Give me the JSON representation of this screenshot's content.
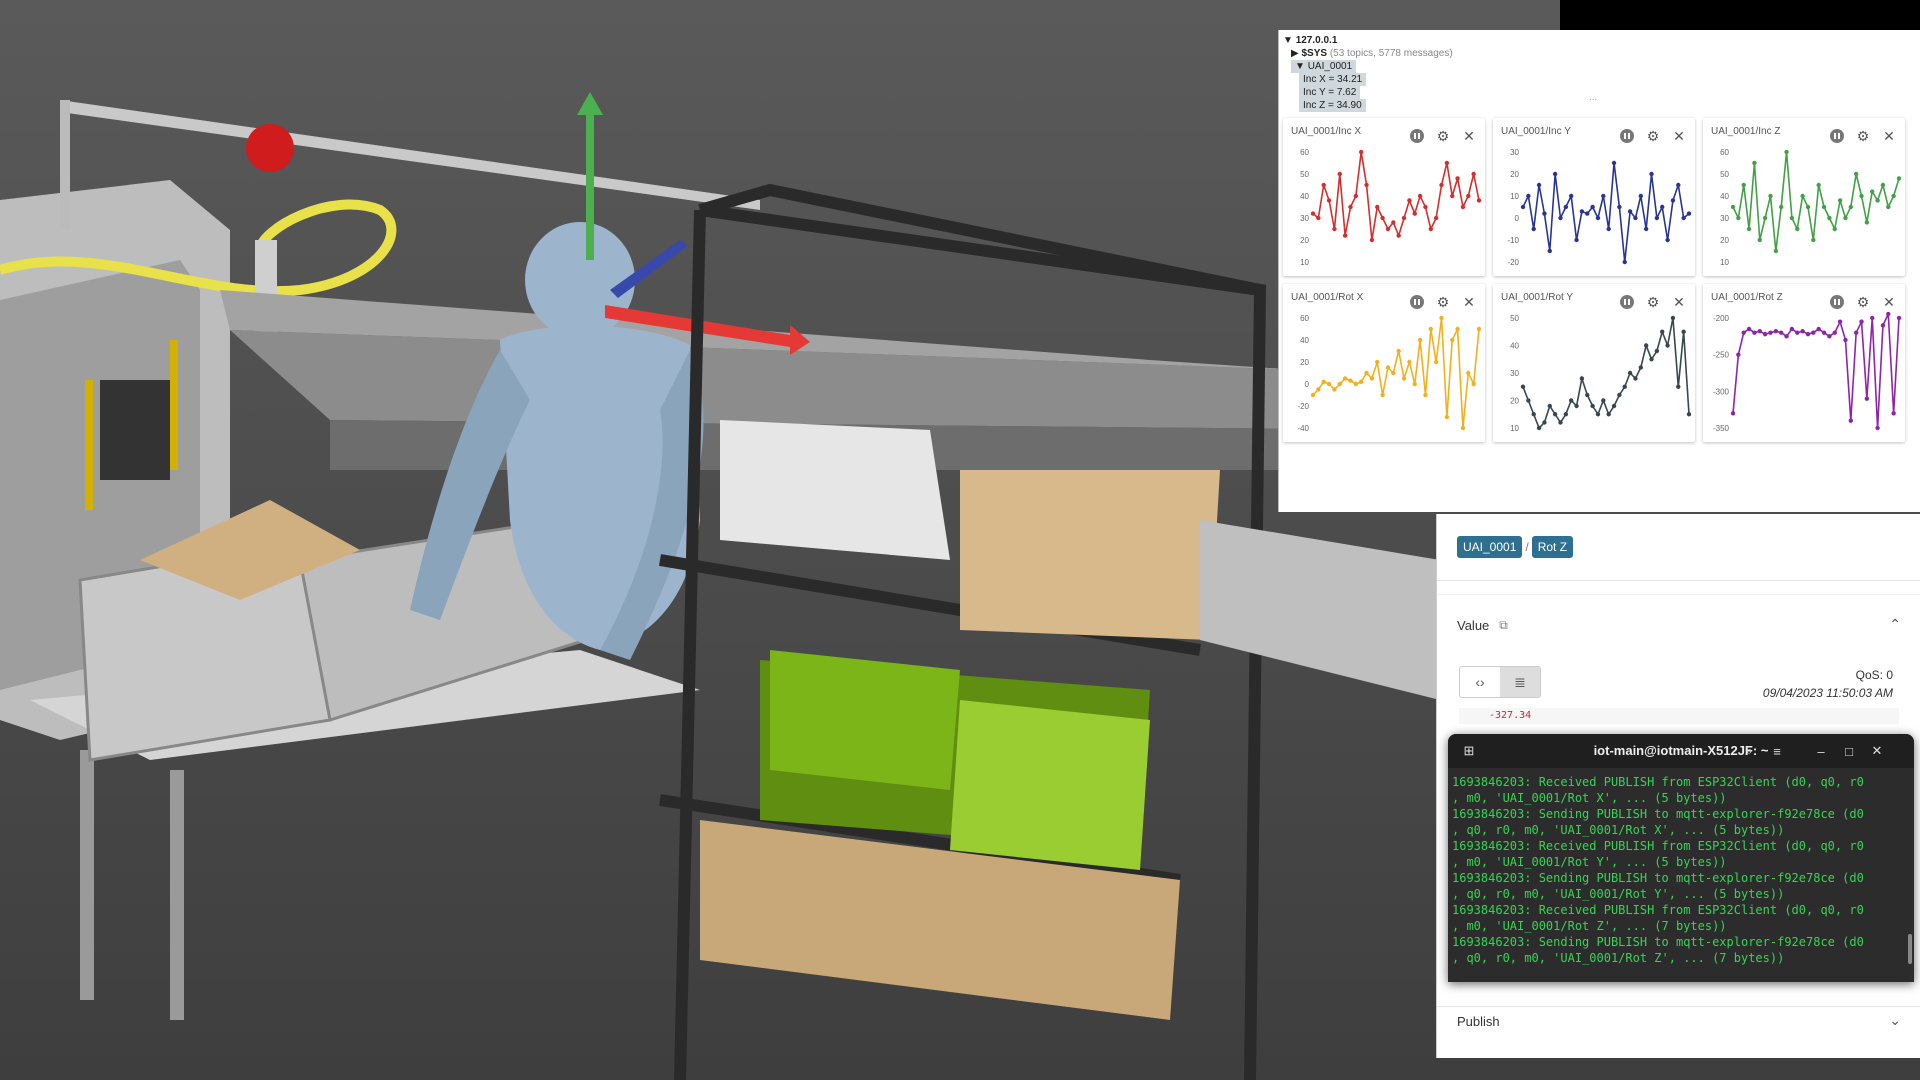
{
  "tree": {
    "root": "127.0.0.1",
    "sys_label": "$SYS",
    "sys_meta": "(53 topics, 5778 messages)",
    "device": "UAI_0001",
    "values": [
      "Inc X = 34.21",
      "Inc Y = 7.62",
      "Inc Z = 34.90"
    ],
    "more": "..."
  },
  "charts": [
    {
      "title": "UAI_0001/Inc X",
      "color": "#d32f2f",
      "yticks": [
        "60",
        "50",
        "40",
        "30",
        "20",
        "10"
      ]
    },
    {
      "title": "UAI_0001/Inc Y",
      "color": "#283593",
      "yticks": [
        "30",
        "20",
        "10",
        "0",
        "-10",
        "-20"
      ]
    },
    {
      "title": "UAI_0001/Inc Z",
      "color": "#43a047",
      "yticks": [
        "60",
        "50",
        "40",
        "30",
        "20",
        "10"
      ]
    },
    {
      "title": "UAI_0001/Rot X",
      "color": "#f2b01e",
      "yticks": [
        "60",
        "40",
        "20",
        "0",
        "-20",
        "-40"
      ]
    },
    {
      "title": "UAI_0001/Rot Y",
      "color": "#37474f",
      "yticks": [
        "50",
        "40",
        "30",
        "20",
        "10"
      ]
    },
    {
      "title": "UAI_0001/Rot Z",
      "color": "#8e24aa",
      "yticks": [
        "-200",
        "-250",
        "-300",
        "-350"
      ]
    }
  ],
  "chart_data": [
    {
      "type": "line",
      "series": [
        {
          "values": [
            32,
            30,
            45,
            38,
            25,
            50,
            22,
            35,
            40,
            60,
            45,
            20,
            35,
            30,
            25,
            28,
            22,
            30,
            38,
            32,
            40,
            35,
            25,
            30,
            45,
            55,
            40,
            48,
            35,
            40,
            50,
            38
          ]
        }
      ]
    },
    {
      "type": "line",
      "series": [
        {
          "values": [
            5,
            10,
            -5,
            15,
            2,
            -15,
            20,
            0,
            5,
            10,
            -10,
            3,
            2,
            5,
            0,
            10,
            -5,
            25,
            5,
            -20,
            3,
            0,
            10,
            -5,
            20,
            0,
            5,
            -10,
            8,
            15,
            0,
            2
          ]
        }
      ]
    },
    {
      "type": "line",
      "series": [
        {
          "values": [
            35,
            30,
            45,
            25,
            55,
            20,
            30,
            40,
            15,
            35,
            60,
            30,
            25,
            40,
            35,
            20,
            45,
            35,
            30,
            25,
            38,
            30,
            35,
            50,
            40,
            28,
            42,
            38,
            45,
            35,
            40,
            48
          ]
        }
      ]
    },
    {
      "type": "line",
      "series": [
        {
          "values": [
            -10,
            -5,
            2,
            0,
            -5,
            0,
            5,
            3,
            0,
            2,
            10,
            5,
            20,
            -10,
            15,
            10,
            30,
            5,
            20,
            0,
            40,
            -10,
            50,
            20,
            60,
            -30,
            40,
            50,
            -40,
            10,
            0,
            50
          ]
        }
      ]
    },
    {
      "type": "line",
      "series": [
        {
          "values": [
            25,
            20,
            15,
            10,
            12,
            18,
            15,
            12,
            15,
            20,
            18,
            28,
            22,
            18,
            15,
            20,
            15,
            18,
            22,
            25,
            30,
            28,
            32,
            40,
            35,
            38,
            45,
            40,
            50,
            25,
            45,
            15
          ]
        }
      ]
    },
    {
      "type": "line",
      "series": [
        {
          "values": [
            -330,
            -250,
            -220,
            -215,
            -220,
            -218,
            -222,
            -220,
            -218,
            -220,
            -225,
            -215,
            -220,
            -218,
            -222,
            -220,
            -215,
            -220,
            -225,
            -220,
            -205,
            -230,
            -340,
            -220,
            -205,
            -310,
            -200,
            -350,
            -210,
            -190,
            -330,
            -200
          ]
        }
      ]
    }
  ],
  "detail": {
    "breadcrumb": [
      "UAI_0001",
      "Rot Z"
    ],
    "breadcrumb_sep": "/",
    "value_label": "Value",
    "qos": "QoS: 0",
    "timestamp": "09/04/2023 11:50:03 AM",
    "preview_value": "-327.34",
    "publish_label": "Publish"
  },
  "terminal": {
    "title": "iot-main@iotmain-X512JF: ~",
    "lines": [
      "1693846203: Received PUBLISH from ESP32Client (d0, q0, r0",
      ", m0, 'UAI_0001/Rot X', ... (5 bytes))",
      "1693846203: Sending PUBLISH to mqtt-explorer-f92e78ce (d0",
      ", q0, r0, m0, 'UAI_0001/Rot X', ... (5 bytes))",
      "1693846203: Received PUBLISH from ESP32Client (d0, q0, r0",
      ", m0, 'UAI_0001/Rot Y', ... (5 bytes))",
      "1693846203: Sending PUBLISH to mqtt-explorer-f92e78ce (d0",
      ", q0, r0, m0, 'UAI_0001/Rot Y', ... (5 bytes))",
      "1693846203: Received PUBLISH from ESP32Client (d0, q0, r0",
      ", m0, 'UAI_0001/Rot Z', ... (7 bytes))",
      "1693846203: Sending PUBLISH to mqtt-explorer-f92e78ce (d0",
      ", q0, r0, m0, 'UAI_0001/Rot Z', ... (7 bytes))"
    ]
  },
  "colors": {
    "accent": "#2f6f8f",
    "terminal_text": "#39d353"
  }
}
